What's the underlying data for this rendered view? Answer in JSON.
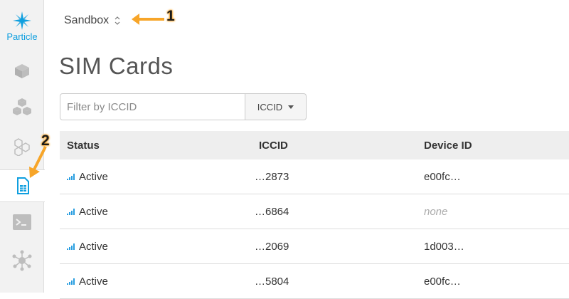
{
  "sidebar": {
    "logo_label": "Particle",
    "items": [
      {
        "icon": "cube-icon"
      },
      {
        "icon": "cubes-icon"
      },
      {
        "icon": "hexagons-icon"
      },
      {
        "icon": "sim-card-icon",
        "active": true
      },
      {
        "icon": "terminal-icon"
      },
      {
        "icon": "network-icon"
      }
    ]
  },
  "header": {
    "org_name": "Sandbox",
    "page_title": "SIM Cards"
  },
  "filter": {
    "placeholder": "Filter by ICCID",
    "select_value": "ICCID"
  },
  "table": {
    "columns": [
      "Status",
      "ICCID",
      "Device ID"
    ],
    "rows": [
      {
        "status": "Active",
        "iccid": "…2873",
        "device_id": "e00fc…"
      },
      {
        "status": "Active",
        "iccid": "…6864",
        "device_id": "none"
      },
      {
        "status": "Active",
        "iccid": "…2069",
        "device_id": "1d003…"
      },
      {
        "status": "Active",
        "iccid": "…5804",
        "device_id": "e00fc…"
      }
    ]
  },
  "annotations": {
    "one": "1",
    "two": "2"
  },
  "colors": {
    "accent": "#0f9fdf",
    "signal": "#2a9ee0",
    "annotation_arrow": "#f7a529"
  }
}
